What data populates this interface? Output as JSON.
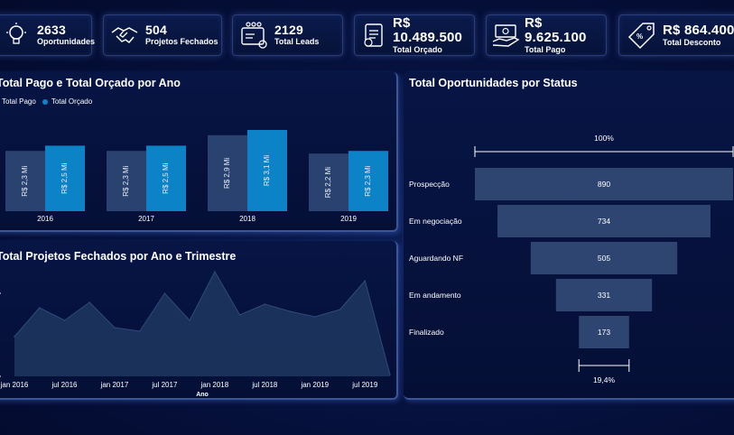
{
  "kpis": [
    {
      "value": "2633",
      "label": "Oportunidades",
      "icon": "lightbulb-icon"
    },
    {
      "value": "504",
      "label": "Projetos Fechados",
      "icon": "handshake-icon"
    },
    {
      "value": "2129",
      "label": "Total Leads",
      "icon": "leads-dashboard-icon"
    },
    {
      "value": "R$ 10.489.500",
      "label": "Total Orçado",
      "icon": "budget-document-icon"
    },
    {
      "value": "R$ 9.625.100",
      "label": "Total Pago",
      "icon": "money-hand-icon"
    },
    {
      "value": "R$ 864.400",
      "label": "Total Desconto",
      "icon": "discount-tag-icon"
    }
  ],
  "colors": {
    "pago": "#2a4270",
    "orcado": "#0b83c6",
    "area": "#1e3760",
    "funnel": "#2d4570"
  },
  "bar_panel": {
    "title": "Total Pago e Total Orçado por Ano"
  },
  "area_panel": {
    "title": "Total Projetos Fechados por Ano e Trimestre",
    "xlabel": "Ano"
  },
  "funnel_panel": {
    "title": "Total Oportunidades por Status",
    "top_pct": "100%",
    "bottom_pct": "19,4%"
  },
  "chart_data": [
    {
      "type": "bar",
      "title": "Total Pago e Total Orçado por Ano",
      "categories": [
        "2016",
        "2017",
        "2018",
        "2019"
      ],
      "series": [
        {
          "name": "Total Pago",
          "values": [
            2.3,
            2.3,
            2.9,
            2.2
          ],
          "labels": [
            "R$ 2,3 Mi",
            "R$ 2,3 Mi",
            "R$ 2,9 Mi",
            "R$ 2,2 Mi"
          ]
        },
        {
          "name": "Total Orçado",
          "values": [
            2.5,
            2.5,
            3.1,
            2.3
          ],
          "labels": [
            "R$ 2,5 Mi",
            "R$ 2,5 Mi",
            "R$ 3,1 Mi",
            "R$ 2,3 Mi"
          ]
        }
      ],
      "ylim": [
        0,
        3.1
      ]
    },
    {
      "type": "area",
      "title": "Total Projetos Fechados por Ano e Trimestre",
      "xlabel": "Ano",
      "x": [
        "2016 T1",
        "2016 T2",
        "2016 T3",
        "2016 T4",
        "2017 T1",
        "2017 T2",
        "2017 T3",
        "2017 T4",
        "2018 T1",
        "2018 T2",
        "2018 T3",
        "2018 T4",
        "2019 T1",
        "2019 T2",
        "2019 T3",
        "2019 T4"
      ],
      "values": [
        22,
        38,
        31,
        41,
        27,
        25,
        46,
        31,
        58,
        34,
        40,
        36,
        33,
        37,
        53,
        1
      ],
      "x_ticks": [
        "jan 2016",
        "jul 2016",
        "jan 2017",
        "jul 2017",
        "jan 2018",
        "jul 2018",
        "jan 2019",
        "jul 2019"
      ],
      "ylim": [
        0,
        60
      ]
    },
    {
      "type": "funnel",
      "title": "Total Oportunidades por Status",
      "categories": [
        "Prospecção",
        "Em negociação",
        "Aguardando NF",
        "Em andamento",
        "Finalizado"
      ],
      "values": [
        890,
        734,
        505,
        331,
        173
      ]
    }
  ]
}
